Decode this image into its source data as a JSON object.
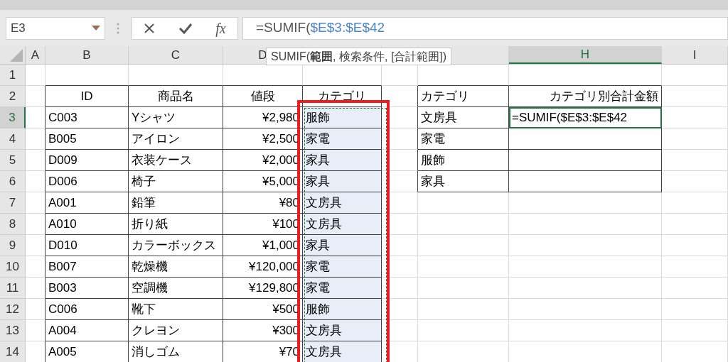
{
  "name_box": {
    "value": "E3"
  },
  "formula_bar": {
    "function_label": "fx",
    "prefix": "=SUMIF(",
    "reference": "$E$3:$E$42"
  },
  "tooltip": "SUMIF(**範囲**, 検索条件, [合計範囲])",
  "column_headers": [
    {
      "label": "A",
      "selected": false
    },
    {
      "label": "B",
      "selected": false
    },
    {
      "label": "C",
      "selected": false
    },
    {
      "label": "D",
      "selected": false
    },
    {
      "label": "H",
      "selected": true
    },
    {
      "label": "I",
      "selected": false
    }
  ],
  "row_headers": [
    {
      "label": "1",
      "selected": false
    },
    {
      "label": "2",
      "selected": false
    },
    {
      "label": "3",
      "selected": true
    },
    {
      "label": "4",
      "selected": false
    },
    {
      "label": "5",
      "selected": false
    },
    {
      "label": "6",
      "selected": false
    },
    {
      "label": "7",
      "selected": false
    },
    {
      "label": "8",
      "selected": false
    },
    {
      "label": "9",
      "selected": false
    },
    {
      "label": "10",
      "selected": false
    },
    {
      "label": "11",
      "selected": false
    },
    {
      "label": "12",
      "selected": false
    },
    {
      "label": "13",
      "selected": false
    },
    {
      "label": "14",
      "selected": false
    }
  ],
  "products_table": {
    "columns": [
      {
        "label": "ID",
        "referenced": false
      },
      {
        "label": "商品名",
        "referenced": false
      },
      {
        "label": "値段",
        "referenced": false
      },
      {
        "label": "カテゴリ",
        "referenced": true
      }
    ],
    "rows": [
      [
        "C003",
        "Yシャツ",
        "¥2,980",
        "服飾"
      ],
      [
        "B005",
        "アイロン",
        "¥2,500",
        "家電"
      ],
      [
        "D009",
        "衣装ケース",
        "¥2,000",
        "家具"
      ],
      [
        "D006",
        "椅子",
        "¥5,000",
        "家具"
      ],
      [
        "A001",
        "鉛筆",
        "¥80",
        "文房具"
      ],
      [
        "A010",
        "折り紙",
        "¥100",
        "文房具"
      ],
      [
        "D010",
        "カラーボックス",
        "¥1,000",
        "家具"
      ],
      [
        "B007",
        "乾燥機",
        "¥120,000",
        "家電"
      ],
      [
        "B003",
        "空調機",
        "¥129,800",
        "家電"
      ],
      [
        "C006",
        "靴下",
        "¥500",
        "服飾"
      ],
      [
        "A004",
        "クレヨン",
        "¥300",
        "文房具"
      ],
      [
        "A005",
        "消しゴム",
        "¥70",
        "文房具"
      ]
    ]
  },
  "summary_table": {
    "columns": [
      "カテゴリ",
      "カテゴリ別合計金額"
    ],
    "rows": [
      {
        "category": "文房具",
        "total": "=SUMIF($E$3:$E$42",
        "editing": true
      },
      {
        "category": "家電",
        "editing": false
      },
      {
        "category": "服飾",
        "editing": false
      },
      {
        "category": "家具",
        "editing": false
      }
    ]
  },
  "highlight_frame": {
    "on": true
  }
}
